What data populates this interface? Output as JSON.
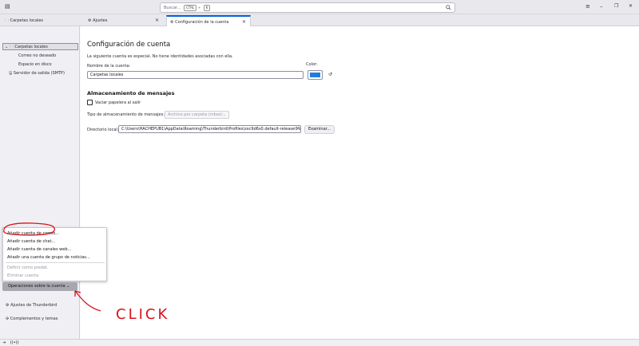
{
  "topbar": {
    "search_placeholder": "Buscar...",
    "shortcut_key": "CTRL",
    "shortcut_letter": "K",
    "search_icon": "magnifier-icon",
    "menu_icon": "≡",
    "minimize_icon": "–",
    "restore_icon": "❐",
    "close_icon": "✕"
  },
  "tabs": [
    {
      "label": "Carpetas locales",
      "icon": "folder-icon"
    },
    {
      "label": "Ajustes",
      "icon": "gear-icon"
    },
    {
      "label": "Configuración de la cuenta",
      "icon": "account-settings-icon"
    }
  ],
  "tab_close": "×",
  "sidebar": {
    "account": "Carpetas locales",
    "folders": [
      "Correo no deseado",
      "Espacio en disco"
    ],
    "smtp": "Servidor de salida (SMTP)",
    "settings_label": "Ajustes de Thunderbird",
    "addons_label": "Complementos y temas"
  },
  "popup_menu": {
    "items": [
      {
        "label": "Añadir cuenta de correo...",
        "enabled": true
      },
      {
        "label": "Añadir cuenta de chat...",
        "enabled": true
      },
      {
        "label": "Añadir cuenta de canales web...",
        "enabled": true
      },
      {
        "label": "Añadir una cuenta de grupo de noticias...",
        "enabled": true
      },
      {
        "label": "Definir como predet.",
        "enabled": false
      },
      {
        "label": "Eliminar cuenta",
        "enabled": false
      }
    ]
  },
  "operations_button": "Operaciones sobre la cuenta",
  "main": {
    "title": "Configuración de cuenta",
    "description": "La siguiente cuenta es especial. No tiene identidades asociadas con ella.",
    "account_name_label": "Nombre de la cuenta:",
    "account_name_value": "Carpetas locales",
    "color_label": "Color:",
    "color_value": "#1f7ee3",
    "storage_heading": "Almacenamiento de mensajes",
    "empty_trash_label": "Vaciar papelera al salir",
    "storage_type_label": "Tipo de almacenamiento de mensajes:",
    "storage_type_value": "Archivo por carpeta (mbox)",
    "local_dir_label": "Directorio local:",
    "local_dir_value": "C:\\Users\\HACHEPUB1\\AppData\\Roaming\\Thunderbird\\Profiles\\zxc9d6s0.default-release\\Mai",
    "browse_button": "Examinar..."
  },
  "annotation": {
    "text": "CLICK",
    "color": "#d8121b"
  }
}
